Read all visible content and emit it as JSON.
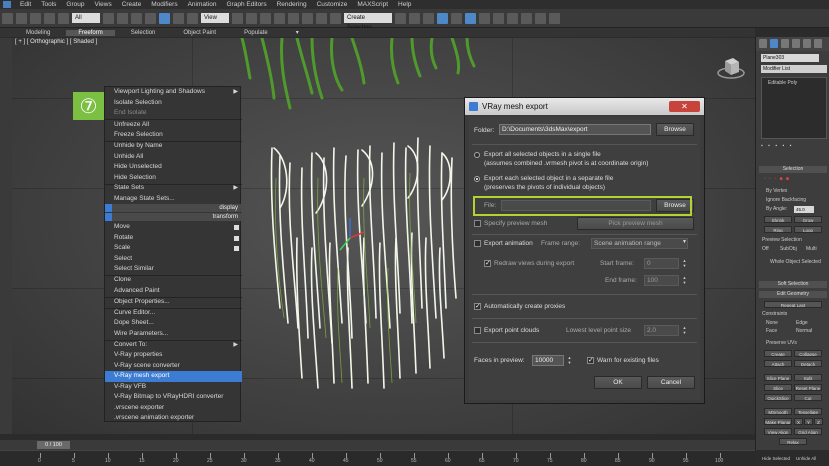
{
  "menubar": {
    "items": [
      "Edit",
      "Tools",
      "Group",
      "Views",
      "Create",
      "Modifiers",
      "Animation",
      "Graph Editors",
      "Rendering",
      "Customize",
      "MAXScript",
      "Help"
    ]
  },
  "toolbar": {
    "selection_filter": "All",
    "reference_coord": "View",
    "named_selection": "Create Selection"
  },
  "ribbon": {
    "tabs": [
      "Modeling",
      "Freeform",
      "Selection",
      "Object Paint",
      "Populate"
    ],
    "active": "Freeform"
  },
  "viewport": {
    "label": "[ + ] [ Orthographic ] [ Shaded ]"
  },
  "step_badge": "⑦",
  "quad_menu": {
    "items": [
      {
        "label": "Viewport Lighting and Shadows",
        "arrow": true,
        "state": "normal"
      },
      {
        "label": "Isolate Selection",
        "state": "normal"
      },
      {
        "label": "End Isolate",
        "state": "disabled"
      },
      {
        "label": "Unfreeze All",
        "state": "normal"
      },
      {
        "label": "Freeze Selection",
        "state": "normal"
      },
      {
        "label": "Unhide by Name",
        "state": "normal"
      },
      {
        "label": "Unhide All",
        "state": "normal"
      },
      {
        "label": "Hide Unselected",
        "state": "normal"
      },
      {
        "label": "Hide Selection",
        "state": "normal"
      },
      {
        "label": "State Sets",
        "arrow": true,
        "state": "normal"
      },
      {
        "label": "Manage State Sets...",
        "state": "normal"
      }
    ],
    "header_display": "display",
    "header_transform": "transform",
    "transform_items": [
      {
        "label": "Move",
        "check": true
      },
      {
        "label": "Rotate",
        "check": true
      },
      {
        "label": "Scale",
        "check": true
      },
      {
        "label": "Select"
      },
      {
        "label": "Select Similar"
      },
      {
        "label": "Clone"
      },
      {
        "label": "Advanced Paint"
      },
      {
        "label": "Object Properties..."
      },
      {
        "label": "Curve Editor..."
      },
      {
        "label": "Dope Sheet..."
      },
      {
        "label": "Wire Parameters..."
      },
      {
        "label": "Convert To:",
        "arrow": true
      },
      {
        "label": "V-Ray properties"
      },
      {
        "label": "V-Ray scene converter"
      },
      {
        "label": "V-Ray mesh export",
        "selected": true
      },
      {
        "label": "V-Ray VFB"
      },
      {
        "label": "V-Ray Bitmap to VRayHDRI converter"
      },
      {
        "label": ".vrscene exporter"
      },
      {
        "label": ".vrscene animation exporter"
      }
    ]
  },
  "dialog": {
    "title": "VRay mesh export",
    "close": "✕",
    "folder_label": "Folder:",
    "folder_value": "D:\\Documents\\3dsMax\\export",
    "browse": "Browse",
    "option1_line1": "Export all selected objects in a single file",
    "option1_line2": "(assumes combined .vrmesh pivot is at coordinate origin)",
    "option2_line1": "Export each selected object in a separate file",
    "option2_line2": "(preserves the pivots of individual objects)",
    "file_label": "File:",
    "file_value": "",
    "file_browse": "Browse",
    "specify_preview": "Specify preview mesh",
    "pick_preview": "Pick preview mesh",
    "export_animation": "Export animation",
    "frame_range_label": "Frame range:",
    "frame_range_value": "Scene animation range",
    "redraw": "Redraw views during export",
    "start_frame_label": "Start frame:",
    "start_frame_value": "0",
    "end_frame_label": "End frame:",
    "end_frame_value": "100",
    "auto_proxies": "Automatically create proxies",
    "export_point_clouds": "Export point clouds",
    "lowest_level_label": "Lowest level point size",
    "lowest_level_value": "2.0",
    "faces_label": "Faces in preview:",
    "faces_value": "10000",
    "warn": "Warn for existing files",
    "ok": "OK",
    "cancel": "Cancel"
  },
  "command_panel": {
    "object_name": "Plane303",
    "modifier_list": "Modifier List",
    "stack_item": "Editable Poly",
    "selection_roll": "Selection",
    "by_vertex": "By Vertex",
    "ignore_backfacing": "Ignore Backfacing",
    "by_angle": "By Angle:",
    "by_angle_value": "45.0",
    "shrink": "Shrink",
    "grow": "Grow",
    "ring": "Ring",
    "loop": "Loop",
    "preview_selection": "Preview Selection",
    "off": "Off",
    "subobj": "SubObj",
    "multi": "Multi",
    "whole_object": "Whole Object Selected",
    "soft_selection": "Soft Selection",
    "edit_geometry": "Edit Geometry",
    "repeat_last": "Repeat Last",
    "constraints": "Constraints",
    "none": "None",
    "edge": "Edge",
    "face": "Face",
    "normal": "Normal",
    "preserve_uvs": "Preserve UVs",
    "create": "Create",
    "collapse": "Collapse",
    "attach": "Attach",
    "detach": "Detach",
    "slice_plane": "Slice Plane",
    "split": "Split",
    "slice": "Slice",
    "reset_plane": "Reset Plane",
    "quickslice": "QuickSlice",
    "cut": "Cut",
    "msmooth": "MSmooth",
    "tessellate": "Tessellate",
    "make_planar": "Make Planar",
    "x": "X",
    "y": "Y",
    "z": "Z",
    "view_align": "View Align",
    "grid_align": "Grid Align",
    "relax": "Relax",
    "hide_selected": "Hide Selected",
    "unhide_all": "Unhide All"
  },
  "timeline": {
    "slider": "0 / 100",
    "ticks": [
      "0",
      "5",
      "10",
      "15",
      "20",
      "25",
      "30",
      "35",
      "40",
      "45",
      "50",
      "55",
      "60",
      "65",
      "70",
      "75",
      "80",
      "85",
      "90",
      "95",
      "100"
    ]
  },
  "colors": {
    "accent_blue": "#3d7cd3",
    "highlight_green": "#b3d430",
    "badge_green": "#7bc043",
    "close_red": "#c7443c"
  }
}
